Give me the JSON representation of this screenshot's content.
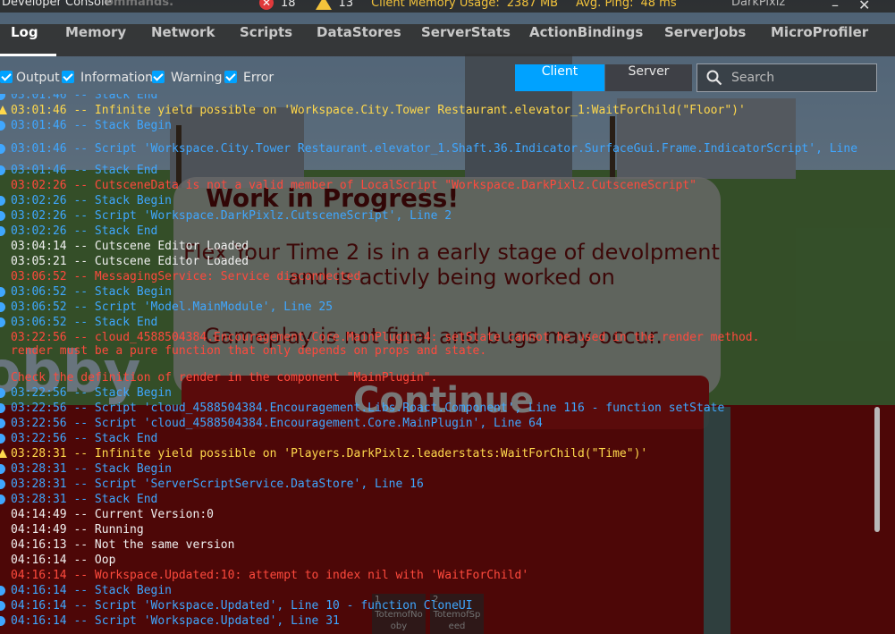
{
  "console": {
    "title": "Developer Console",
    "title_overlap": "ommands.",
    "stats": {
      "error_count": "18",
      "warning_count": "13",
      "memory_label": "Client Memory Usage:",
      "memory_value": "2387 MB",
      "ping_label": "Avg. Ping:",
      "ping_value": "48 ms"
    },
    "user": "DarkPixlz",
    "tabs": [
      "Log",
      "Memory",
      "Network",
      "Scripts",
      "DataStores",
      "ServerStats",
      "ActionBindings",
      "ServerJobs",
      "MicroProfiler"
    ],
    "active_tab": "Log",
    "filters": [
      "Output",
      "Information",
      "Warning",
      "Error"
    ],
    "toggles": {
      "client": "Client",
      "server": "Server"
    },
    "search_placeholder": "Search",
    "colors": {
      "info": "#3fa7ff",
      "warning": "#ffd84c",
      "error": "#ff4a3d",
      "output": "#f0f0f0",
      "accent": "#00a2ff"
    }
  },
  "log": [
    {
      "type": "info",
      "text": "03:01:46 -- Stack End"
    },
    {
      "type": "warning",
      "text": "03:01:46 -- Infinite yield possible on 'Workspace.City.Tower Restaurant.elevator_1:WaitForChild(\"Floor\")'"
    },
    {
      "type": "info",
      "text": "03:01:46 -- Stack Begin"
    },
    {
      "type": "info",
      "text": "03:01:46 -- Script 'Workspace.City.Tower Restaurant.elevator_1.Shaft.36.Indicator.SurfaceGui.Frame.IndicatorScript', Line"
    },
    {
      "type": "info",
      "text": "03:01:46 -- Stack End"
    },
    {
      "type": "error",
      "text": "03:02:26 -- CutsceneData is not a valid member of LocalScript \"Workspace.DarkPixlz.CutsceneScript\""
    },
    {
      "type": "info",
      "text": "03:02:26 -- Stack Begin"
    },
    {
      "type": "info",
      "text": "03:02:26 -- Script 'Workspace.DarkPixlz.CutsceneScript', Line 2"
    },
    {
      "type": "info",
      "text": "03:02:26 -- Stack End"
    },
    {
      "type": "output",
      "text": "03:04:14 -- Cutscene Editor Loaded"
    },
    {
      "type": "output",
      "text": "03:05:21 -- Cutscene Editor Loaded"
    },
    {
      "type": "error",
      "text": "03:06:52 -- MessagingService: Service disconnected"
    },
    {
      "type": "info",
      "text": "03:06:52 -- Stack Begin"
    },
    {
      "type": "info",
      "text": "03:06:52 -- Script 'Model.MainModule', Line 25"
    },
    {
      "type": "info",
      "text": "03:06:52 -- Stack End"
    },
    {
      "type": "error",
      "text": "03:22:56 -- cloud_4588504384.Encouragement.Core.MainPlugin:4: setState cannot be used in the render method."
    },
    {
      "type": "error",
      "text": "render must be a pure function that only depends on props and state."
    },
    {
      "type": "error",
      "text": "Check the definition of render in the component \"MainPlugin\"."
    },
    {
      "type": "info",
      "text": "03:22:56 -- Stack Begin"
    },
    {
      "type": "info",
      "text": "03:22:56 -- Script 'cloud_4588504384.Encouragement.Libs.Roact.Component', Line 116 - function setState"
    },
    {
      "type": "info",
      "text": "03:22:56 -- Script 'cloud_4588504384.Encouragement.Core.MainPlugin', Line 64"
    },
    {
      "type": "info",
      "text": "03:22:56 -- Stack End"
    },
    {
      "type": "warning",
      "text": "03:28:31 -- Infinite yield possible on 'Players.DarkPixlz.leaderstats:WaitForChild(\"Time\")'"
    },
    {
      "type": "info",
      "text": "03:28:31 -- Stack Begin"
    },
    {
      "type": "info",
      "text": "03:28:31 -- Script 'ServerScriptService.DataStore', Line 16"
    },
    {
      "type": "info",
      "text": "03:28:31 -- Stack End"
    },
    {
      "type": "output",
      "text": "04:14:49 -- Current Version:0"
    },
    {
      "type": "output",
      "text": "04:14:49 -- Running"
    },
    {
      "type": "output",
      "text": "04:16:13 -- Not the same version"
    },
    {
      "type": "output",
      "text": "04:16:14 -- Oop"
    },
    {
      "type": "error",
      "text": "04:16:14 -- Workspace.Updated:10: attempt to index nil with 'WaitForChild'"
    },
    {
      "type": "info",
      "text": "04:16:14 -- Stack Begin"
    },
    {
      "type": "info",
      "text": "04:16:14 -- Script 'Workspace.Updated', Line 10 - function CloneUI"
    },
    {
      "type": "info",
      "text": "04:16:14 -- Script 'Workspace.Updated', Line 31"
    }
  ],
  "game": {
    "wip_title": "Work in Progress!",
    "wip_body": "Flex Your Time 2  is in a early stage of devolpment and is activly being worked on",
    "wip_note": "Gameplay is not final and bugs may occur.",
    "continue_label": "Continue",
    "background_text": "obby",
    "hotbar": [
      {
        "slot": "1",
        "name": "TotemofNo oby"
      },
      {
        "slot": "2",
        "name": "TotemofSp eed"
      }
    ]
  }
}
